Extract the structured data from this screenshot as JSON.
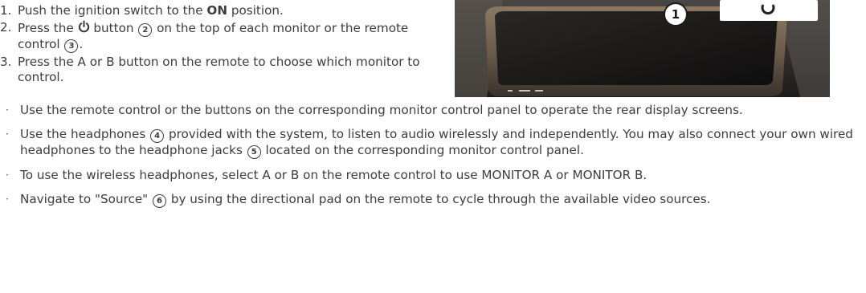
{
  "steps": [
    {
      "num": "1.",
      "text_before": "Push the ignition switch to the ",
      "bold": "ON",
      "text_after": " position."
    },
    {
      "num": "2.",
      "text_before": "Press the ",
      "icon": "power-icon",
      "text_mid": " button ",
      "callout_a": "2",
      "text_mid2": " on the top of each monitor or the remote control ",
      "callout_b": "3",
      "text_after": "."
    },
    {
      "num": "3.",
      "text": "Press the A or B button on the remote to choose which monitor to control."
    }
  ],
  "photo": {
    "callout": "1"
  },
  "bullets": [
    {
      "text": "Use the remote control or the buttons on the corresponding monitor control panel to operate the rear display screens."
    },
    {
      "text_before": "Use the headphones ",
      "callout_a": "4",
      "text_mid": " provided with the system, to listen to audio wirelessly and independently. You may also connect your own wired headphones to the headphone jacks ",
      "callout_b": "5",
      "text_after": " located on the corresponding monitor control panel."
    },
    {
      "text": "To use the wireless headphones, select A or B on the remote control to use MONITOR A or MONITOR B."
    },
    {
      "text_before": "Navigate to \"Source\" ",
      "callout_a": "6",
      "text_after": " by using the directional pad on the remote to cycle through the available video sources."
    }
  ],
  "bullet_glyph": "·"
}
